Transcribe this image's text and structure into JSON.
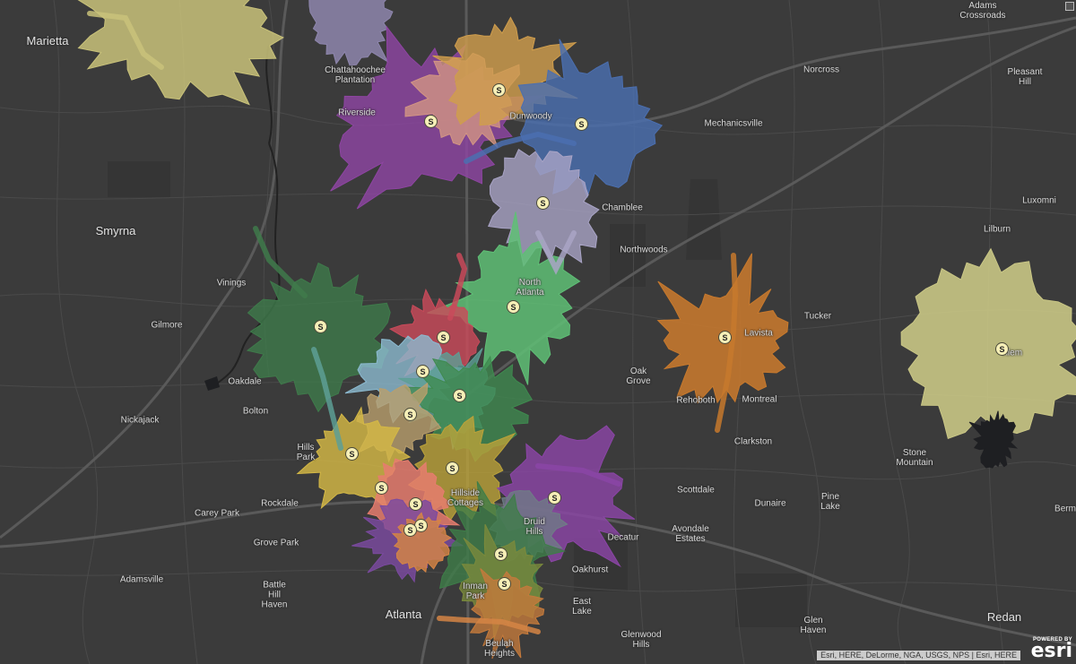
{
  "map": {
    "attribution": "Esri, HERE, DeLorme, NGA, USGS, NPS | Esri, HERE",
    "logo": {
      "powered_by": "POWERED BY",
      "wordmark": "esri"
    },
    "store_symbol": "S",
    "icons": {
      "store": "store-marker-icon",
      "corner": "fullscreen-icon"
    }
  },
  "places": [
    {
      "id": "marietta",
      "lines": [
        "Marietta"
      ],
      "major": true
    },
    {
      "id": "adams",
      "lines": [
        "Adams",
        "Crossroads"
      ]
    },
    {
      "id": "chattahoochee",
      "lines": [
        "Chattahoochee",
        "Plantation"
      ]
    },
    {
      "id": "riverside",
      "lines": [
        "Riverside"
      ]
    },
    {
      "id": "dunwoody",
      "lines": [
        "Dunwoody"
      ]
    },
    {
      "id": "norcross",
      "lines": [
        "Norcross"
      ]
    },
    {
      "id": "pleasant-hill",
      "lines": [
        "Pleasant",
        "Hill"
      ]
    },
    {
      "id": "mechanicsville",
      "lines": [
        "Mechanicsville"
      ]
    },
    {
      "id": "chamblee",
      "lines": [
        "Chamblee"
      ]
    },
    {
      "id": "luxomni",
      "lines": [
        "Luxomni"
      ]
    },
    {
      "id": "smyrna",
      "lines": [
        "Smyrna"
      ],
      "major": true
    },
    {
      "id": "lilburn",
      "lines": [
        "Lilburn"
      ]
    },
    {
      "id": "northwoods",
      "lines": [
        "Northwoods"
      ]
    },
    {
      "id": "north-atlanta",
      "lines": [
        "North",
        "Atlanta"
      ]
    },
    {
      "id": "vinings",
      "lines": [
        "Vinings"
      ]
    },
    {
      "id": "tucker",
      "lines": [
        "Tucker"
      ]
    },
    {
      "id": "gilmore",
      "lines": [
        "Gilmore"
      ]
    },
    {
      "id": "lavista",
      "lines": [
        "Lavista"
      ]
    },
    {
      "id": "tilem",
      "lines": [
        "Tilem"
      ]
    },
    {
      "id": "oak-grove",
      "lines": [
        "Oak",
        "Grove"
      ]
    },
    {
      "id": "oakdale",
      "lines": [
        "Oakdale"
      ]
    },
    {
      "id": "rehoboth",
      "lines": [
        "Rehoboth"
      ]
    },
    {
      "id": "montreal",
      "lines": [
        "Montreal"
      ]
    },
    {
      "id": "bolton",
      "lines": [
        "Bolton"
      ]
    },
    {
      "id": "nickajack",
      "lines": [
        "Nickajack"
      ]
    },
    {
      "id": "clarkston",
      "lines": [
        "Clarkston"
      ]
    },
    {
      "id": "hills-park",
      "lines": [
        "Hills",
        "Park"
      ]
    },
    {
      "id": "stone-mountain",
      "lines": [
        "Stone",
        "Mountain"
      ]
    },
    {
      "id": "scottdale",
      "lines": [
        "Scottdale"
      ]
    },
    {
      "id": "hillside-cottages",
      "lines": [
        "Hillside",
        "Cottages"
      ]
    },
    {
      "id": "rockdale",
      "lines": [
        "Rockdale"
      ]
    },
    {
      "id": "carey-park",
      "lines": [
        "Carey Park"
      ]
    },
    {
      "id": "dunaire",
      "lines": [
        "Dunaire"
      ]
    },
    {
      "id": "pine-lake",
      "lines": [
        "Pine",
        "Lake"
      ]
    },
    {
      "id": "druid-hills",
      "lines": [
        "Druid",
        "Hills"
      ]
    },
    {
      "id": "grove-park",
      "lines": [
        "Grove Park"
      ]
    },
    {
      "id": "decatur",
      "lines": [
        "Decatur"
      ]
    },
    {
      "id": "avondale",
      "lines": [
        "Avondale",
        "Estates"
      ]
    },
    {
      "id": "adamsville",
      "lines": [
        "Adamsville"
      ]
    },
    {
      "id": "battle-hill",
      "lines": [
        "Battle",
        "Hill",
        "Haven"
      ]
    },
    {
      "id": "oakhurst",
      "lines": [
        "Oakhurst"
      ]
    },
    {
      "id": "east-lake",
      "lines": [
        "East",
        "Lake"
      ]
    },
    {
      "id": "inman-park",
      "lines": [
        "Inman",
        "Park"
      ]
    },
    {
      "id": "atlanta",
      "lines": [
        "Atlanta"
      ],
      "major": true
    },
    {
      "id": "glen-haven",
      "lines": [
        "Glen",
        "Haven"
      ]
    },
    {
      "id": "redan",
      "lines": [
        "Redan"
      ],
      "major": true
    },
    {
      "id": "glenwood-hills",
      "lines": [
        "Glenwood",
        "Hills"
      ]
    },
    {
      "id": "beulah-heights",
      "lines": [
        "Beulah",
        "Heights"
      ]
    },
    {
      "id": "berm",
      "lines": [
        "Berm"
      ]
    }
  ],
  "trade_areas": [
    {
      "id": "marietta-ne",
      "color": "#c9c27a"
    },
    {
      "id": "north-top",
      "color": "#8e86ad"
    },
    {
      "id": "dunwoody-west",
      "color": "#8e45a2"
    },
    {
      "id": "dunwoody-pink",
      "color": "#d29583"
    },
    {
      "id": "dunwoody-gold",
      "color": "#cf9d4d"
    },
    {
      "id": "dunwoody-blue",
      "color": "#4b6fb0"
    },
    {
      "id": "chamblee-lavender",
      "color": "#a9a4c6"
    },
    {
      "id": "north-atlanta-green",
      "color": "#5fbf76"
    },
    {
      "id": "vinings-darkgreen",
      "color": "#3f7a4b"
    },
    {
      "id": "buckhead-red",
      "color": "#c94a5a"
    },
    {
      "id": "buckhead-lightblue",
      "color": "#8cbad0"
    },
    {
      "id": "buckhead-teal",
      "color": "#5d9f95"
    },
    {
      "id": "midtown-green",
      "color": "#3f8a4f"
    },
    {
      "id": "west-tan",
      "color": "#b99f6d"
    },
    {
      "id": "hills-park-yellow",
      "color": "#d4b846"
    },
    {
      "id": "midtown-olive",
      "color": "#bba23a"
    },
    {
      "id": "downtown-salmon",
      "color": "#e67d6e"
    },
    {
      "id": "downtown-purple",
      "color": "#7b4aa0"
    },
    {
      "id": "downtown-orange",
      "color": "#d58545"
    },
    {
      "id": "druid-purple",
      "color": "#8b45a6"
    },
    {
      "id": "druid-slate",
      "color": "#6f7e86"
    },
    {
      "id": "inman-darkgreen",
      "color": "#3e7d48"
    },
    {
      "id": "inman-olive",
      "color": "#7a8a3c"
    },
    {
      "id": "beulah-orange",
      "color": "#c47a3c"
    },
    {
      "id": "lavista-orange",
      "color": "#c7792d"
    },
    {
      "id": "tilem-khaki",
      "color": "#c9c685"
    },
    {
      "id": "tilem-lake",
      "color": "#1e1f22"
    }
  ],
  "stores": [
    {
      "id": "store-dunwoody-gold"
    },
    {
      "id": "store-dunwoody-west"
    },
    {
      "id": "store-dunwoody-blue"
    },
    {
      "id": "store-chamblee"
    },
    {
      "id": "store-north-atlanta"
    },
    {
      "id": "store-vinings"
    },
    {
      "id": "store-buckhead-red"
    },
    {
      "id": "store-buckhead-lightblue"
    },
    {
      "id": "store-buckhead-teal"
    },
    {
      "id": "store-midtown-west"
    },
    {
      "id": "store-hills-park"
    },
    {
      "id": "store-midtown-olive"
    },
    {
      "id": "store-downtown-1"
    },
    {
      "id": "store-downtown-2"
    },
    {
      "id": "store-downtown-3"
    },
    {
      "id": "store-downtown-4"
    },
    {
      "id": "store-druid"
    },
    {
      "id": "store-inman-1"
    },
    {
      "id": "store-inman-2"
    },
    {
      "id": "store-lavista"
    },
    {
      "id": "store-tilem"
    }
  ]
}
